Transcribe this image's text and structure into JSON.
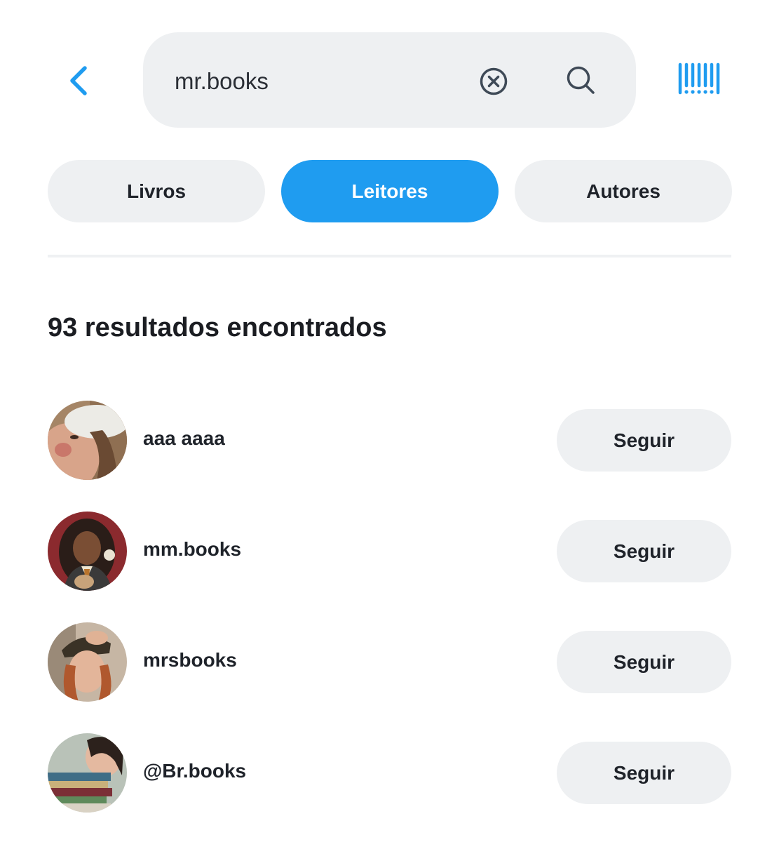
{
  "search": {
    "query": "mr.books"
  },
  "icons": {
    "back": "chevron-left-icon",
    "clear": "close-circle-icon",
    "search": "search-icon",
    "barcode": "barcode-icon"
  },
  "colors": {
    "accent": "#1f9cf0",
    "pill_bg": "#eef0f2",
    "text": "#1f232a",
    "icon_gray": "#3f4a57"
  },
  "tabs": [
    {
      "label": "Livros",
      "active": false
    },
    {
      "label": "Leitores",
      "active": true
    },
    {
      "label": "Autores",
      "active": false
    }
  ],
  "results": {
    "count_text": "93 resultados encontrados",
    "items": [
      {
        "name": "aaa aaaa",
        "follow_label": "Seguir"
      },
      {
        "name": "mm.books",
        "follow_label": "Seguir"
      },
      {
        "name": "mrsbooks",
        "follow_label": "Seguir"
      },
      {
        "name": "@Br.books",
        "follow_label": "Seguir"
      }
    ]
  }
}
